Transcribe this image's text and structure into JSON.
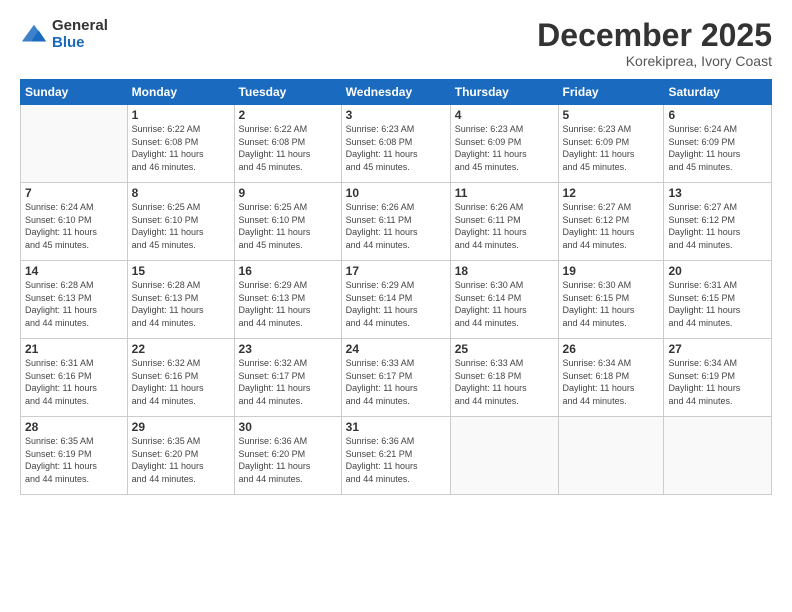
{
  "header": {
    "logo_general": "General",
    "logo_blue": "Blue",
    "month_title": "December 2025",
    "location": "Korekiprea, Ivory Coast"
  },
  "days_of_week": [
    "Sunday",
    "Monday",
    "Tuesday",
    "Wednesday",
    "Thursday",
    "Friday",
    "Saturday"
  ],
  "weeks": [
    [
      {
        "day": "",
        "info": ""
      },
      {
        "day": "1",
        "info": "Sunrise: 6:22 AM\nSunset: 6:08 PM\nDaylight: 11 hours\nand 46 minutes."
      },
      {
        "day": "2",
        "info": "Sunrise: 6:22 AM\nSunset: 6:08 PM\nDaylight: 11 hours\nand 45 minutes."
      },
      {
        "day": "3",
        "info": "Sunrise: 6:23 AM\nSunset: 6:08 PM\nDaylight: 11 hours\nand 45 minutes."
      },
      {
        "day": "4",
        "info": "Sunrise: 6:23 AM\nSunset: 6:09 PM\nDaylight: 11 hours\nand 45 minutes."
      },
      {
        "day": "5",
        "info": "Sunrise: 6:23 AM\nSunset: 6:09 PM\nDaylight: 11 hours\nand 45 minutes."
      },
      {
        "day": "6",
        "info": "Sunrise: 6:24 AM\nSunset: 6:09 PM\nDaylight: 11 hours\nand 45 minutes."
      }
    ],
    [
      {
        "day": "7",
        "info": "Sunrise: 6:24 AM\nSunset: 6:10 PM\nDaylight: 11 hours\nand 45 minutes."
      },
      {
        "day": "8",
        "info": "Sunrise: 6:25 AM\nSunset: 6:10 PM\nDaylight: 11 hours\nand 45 minutes."
      },
      {
        "day": "9",
        "info": "Sunrise: 6:25 AM\nSunset: 6:10 PM\nDaylight: 11 hours\nand 45 minutes."
      },
      {
        "day": "10",
        "info": "Sunrise: 6:26 AM\nSunset: 6:11 PM\nDaylight: 11 hours\nand 44 minutes."
      },
      {
        "day": "11",
        "info": "Sunrise: 6:26 AM\nSunset: 6:11 PM\nDaylight: 11 hours\nand 44 minutes."
      },
      {
        "day": "12",
        "info": "Sunrise: 6:27 AM\nSunset: 6:12 PM\nDaylight: 11 hours\nand 44 minutes."
      },
      {
        "day": "13",
        "info": "Sunrise: 6:27 AM\nSunset: 6:12 PM\nDaylight: 11 hours\nand 44 minutes."
      }
    ],
    [
      {
        "day": "14",
        "info": "Sunrise: 6:28 AM\nSunset: 6:13 PM\nDaylight: 11 hours\nand 44 minutes."
      },
      {
        "day": "15",
        "info": "Sunrise: 6:28 AM\nSunset: 6:13 PM\nDaylight: 11 hours\nand 44 minutes."
      },
      {
        "day": "16",
        "info": "Sunrise: 6:29 AM\nSunset: 6:13 PM\nDaylight: 11 hours\nand 44 minutes."
      },
      {
        "day": "17",
        "info": "Sunrise: 6:29 AM\nSunset: 6:14 PM\nDaylight: 11 hours\nand 44 minutes."
      },
      {
        "day": "18",
        "info": "Sunrise: 6:30 AM\nSunset: 6:14 PM\nDaylight: 11 hours\nand 44 minutes."
      },
      {
        "day": "19",
        "info": "Sunrise: 6:30 AM\nSunset: 6:15 PM\nDaylight: 11 hours\nand 44 minutes."
      },
      {
        "day": "20",
        "info": "Sunrise: 6:31 AM\nSunset: 6:15 PM\nDaylight: 11 hours\nand 44 minutes."
      }
    ],
    [
      {
        "day": "21",
        "info": "Sunrise: 6:31 AM\nSunset: 6:16 PM\nDaylight: 11 hours\nand 44 minutes."
      },
      {
        "day": "22",
        "info": "Sunrise: 6:32 AM\nSunset: 6:16 PM\nDaylight: 11 hours\nand 44 minutes."
      },
      {
        "day": "23",
        "info": "Sunrise: 6:32 AM\nSunset: 6:17 PM\nDaylight: 11 hours\nand 44 minutes."
      },
      {
        "day": "24",
        "info": "Sunrise: 6:33 AM\nSunset: 6:17 PM\nDaylight: 11 hours\nand 44 minutes."
      },
      {
        "day": "25",
        "info": "Sunrise: 6:33 AM\nSunset: 6:18 PM\nDaylight: 11 hours\nand 44 minutes."
      },
      {
        "day": "26",
        "info": "Sunrise: 6:34 AM\nSunset: 6:18 PM\nDaylight: 11 hours\nand 44 minutes."
      },
      {
        "day": "27",
        "info": "Sunrise: 6:34 AM\nSunset: 6:19 PM\nDaylight: 11 hours\nand 44 minutes."
      }
    ],
    [
      {
        "day": "28",
        "info": "Sunrise: 6:35 AM\nSunset: 6:19 PM\nDaylight: 11 hours\nand 44 minutes."
      },
      {
        "day": "29",
        "info": "Sunrise: 6:35 AM\nSunset: 6:20 PM\nDaylight: 11 hours\nand 44 minutes."
      },
      {
        "day": "30",
        "info": "Sunrise: 6:36 AM\nSunset: 6:20 PM\nDaylight: 11 hours\nand 44 minutes."
      },
      {
        "day": "31",
        "info": "Sunrise: 6:36 AM\nSunset: 6:21 PM\nDaylight: 11 hours\nand 44 minutes."
      },
      {
        "day": "",
        "info": ""
      },
      {
        "day": "",
        "info": ""
      },
      {
        "day": "",
        "info": ""
      }
    ]
  ]
}
